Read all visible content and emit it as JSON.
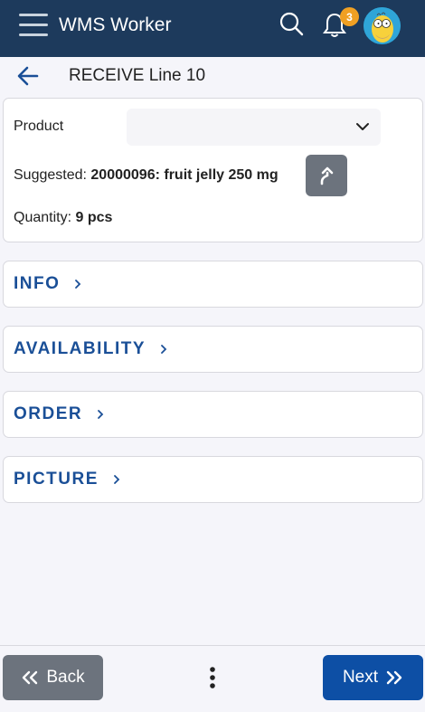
{
  "header": {
    "app_title": "WMS Worker",
    "notification_count": "3",
    "icons": [
      "hamburger-icon",
      "search-icon",
      "bell-icon",
      "avatar"
    ]
  },
  "page": {
    "title": "RECEIVE Line 10"
  },
  "product_card": {
    "product_label": "Product",
    "product_value": "",
    "suggested_label": "Suggested:",
    "suggested_value": "20000096: fruit jelly 250 mg",
    "quantity_label": "Quantity:",
    "quantity_value": "9 pcs"
  },
  "sections": [
    {
      "label": "INFO"
    },
    {
      "label": "AVAILABILITY"
    },
    {
      "label": "ORDER"
    },
    {
      "label": "PICTURE"
    }
  ],
  "footer": {
    "back_label": "Back",
    "next_label": "Next"
  },
  "colors": {
    "header_bg": "#1d3a5c",
    "accent": "#0d4fa5",
    "section_text": "#1a4f97",
    "badge": "#f0a023",
    "secondary_button": "#6c737d"
  }
}
